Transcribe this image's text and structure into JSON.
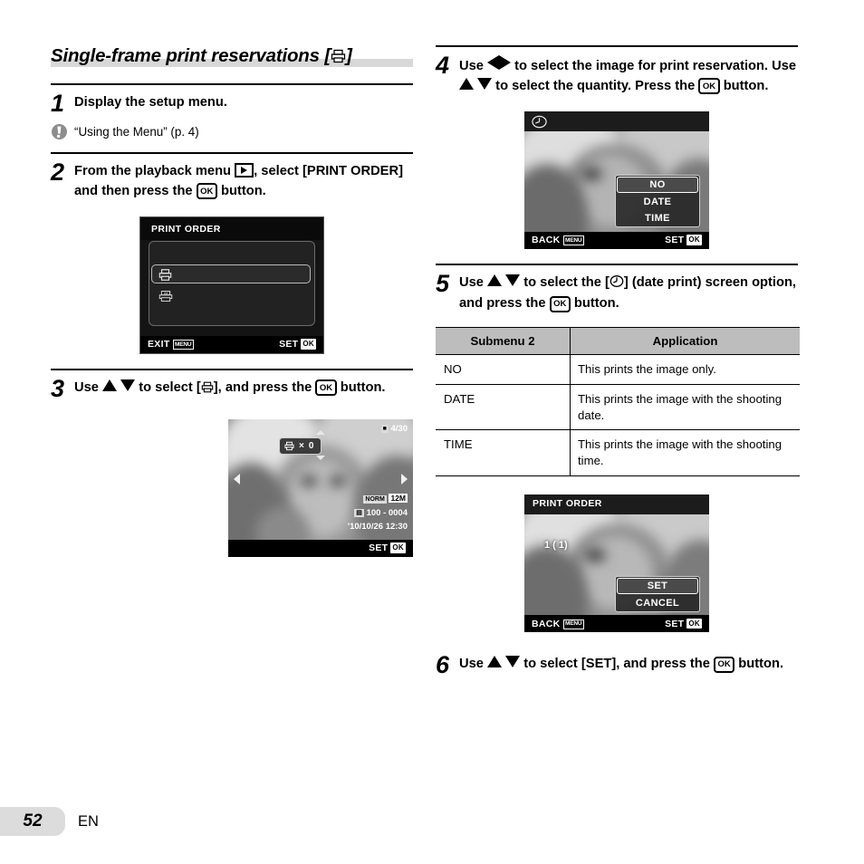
{
  "page": {
    "number": "52",
    "language": "EN"
  },
  "section": {
    "title_prefix": "Single-frame print reservations [",
    "title_suffix": "]",
    "title_icon": "print-single-icon"
  },
  "left_column": {
    "step1": {
      "number": "1",
      "text": "Display the setup menu."
    },
    "note1": {
      "icon": "exclamation-note-icon",
      "text": "“Using the Menu” (p. 4)"
    },
    "step2": {
      "number": "2",
      "text_part1": "From the playback menu ",
      "icon1": "playback-icon",
      "text_part2": ", select [PRINT ORDER] and then press the ",
      "icon2": "ok-button-icon",
      "ok_label": "OK",
      "text_part3": " button."
    },
    "screen1": {
      "name": "print-order-menu-screen",
      "title": "PRINT ORDER",
      "item1_icon": "print-single-icon",
      "item2_icon": "print-all-icon",
      "item2_badge": "ALL",
      "footer_left": "EXIT",
      "footer_left_badge": "MENU",
      "footer_right": "SET",
      "footer_right_badge": "OK"
    },
    "step3": {
      "number": "3",
      "text_part1": "Use ",
      "up_icon": "triangle-up-icon",
      "down_icon": "triangle-down-icon",
      "text_part2": " to select [",
      "icon_print": "print-single-icon",
      "text_part3": "], and press the ",
      "icon_ok": "ok-button-icon",
      "ok_label": "OK",
      "text_part4": " button."
    },
    "screen2": {
      "name": "image-select-quantity-screen",
      "battery_icon": "battery-icon",
      "frame_counter": "4/30",
      "qty_icon": "print-qty-icon",
      "qty_multiply": "×",
      "qty_value": "0",
      "quality_label": "NORM",
      "size_label": "12M",
      "folder_icon": "folder-icon",
      "file_number": "100 - 0004",
      "datetime": "'10/10/26  12:30",
      "footer_right": "SET",
      "footer_right_badge": "OK"
    }
  },
  "right_column": {
    "step4": {
      "number": "4",
      "text_part1": "Use ",
      "left_icon": "triangle-left-icon",
      "right_icon": "triangle-right-icon",
      "text_part2": " to select the image for print reservation. Use ",
      "up_icon": "triangle-up-icon",
      "down_icon": "triangle-down-icon",
      "text_part3": " to select the quantity. Press the ",
      "icon_ok": "ok-button-icon",
      "ok_label": "OK",
      "text_part4": " button."
    },
    "screen3": {
      "name": "date-print-option-screen",
      "top_icon": "date-print-clock-icon",
      "options": [
        {
          "label": "NO",
          "selected": true
        },
        {
          "label": "DATE",
          "selected": false
        },
        {
          "label": "TIME",
          "selected": false
        }
      ],
      "footer_left": "BACK",
      "footer_left_badge": "MENU",
      "footer_right": "SET",
      "footer_right_badge": "OK"
    },
    "step5": {
      "number": "5",
      "text_part1": "Use ",
      "up_icon": "triangle-up-icon",
      "down_icon": "triangle-down-icon",
      "text_part2": " to select the [",
      "icon_date": "date-print-clock-icon",
      "text_part3": "] (date print) screen option, and press the ",
      "icon_ok": "ok-button-icon",
      "ok_label": "OK",
      "text_part4": " button."
    },
    "table": {
      "name": "submenu-application-table",
      "headers": [
        "Submenu 2",
        "Application"
      ],
      "rows": [
        {
          "submenu": "NO",
          "application": "This prints the image only."
        },
        {
          "submenu": "DATE",
          "application": "This prints the image with the shooting date."
        },
        {
          "submenu": "TIME",
          "application": "This prints the image with the shooting time."
        }
      ]
    },
    "screen4": {
      "name": "print-order-confirm-screen",
      "title": "PRINT ORDER",
      "count_text": "1 (  1)",
      "options": [
        {
          "label": "SET",
          "selected": true
        },
        {
          "label": "CANCEL",
          "selected": false
        }
      ],
      "footer_left": "BACK",
      "footer_left_badge": "MENU",
      "footer_right": "SET",
      "footer_right_badge": "OK"
    },
    "step6": {
      "number": "6",
      "text_part1": "Use ",
      "up_icon": "triangle-up-icon",
      "down_icon": "triangle-down-icon",
      "text_part2": " to select [SET], and press the ",
      "icon_ok": "ok-button-icon",
      "ok_label": "OK",
      "text_part3": " button."
    }
  }
}
